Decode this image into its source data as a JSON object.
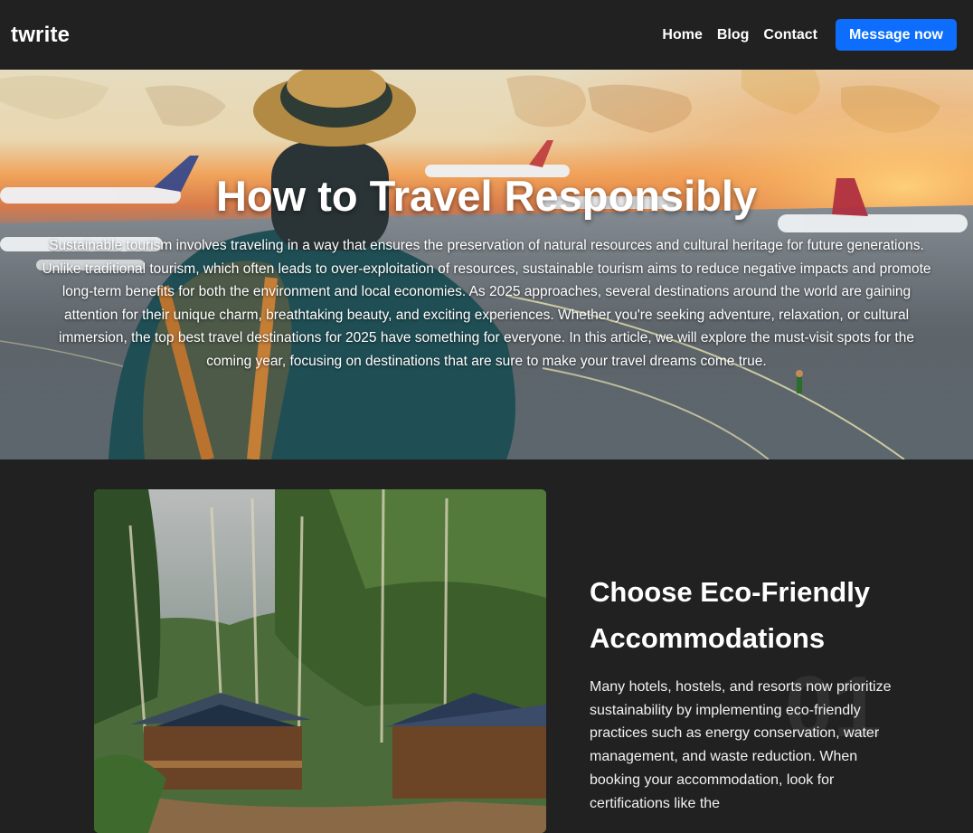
{
  "navbar": {
    "brand": "twrite",
    "links": [
      "Home",
      "Blog",
      "Contact"
    ],
    "cta_label": "Message now",
    "cta_color": "#0d6efd"
  },
  "hero": {
    "title": "How to Travel Responsibly",
    "text": "Sustainable tourism involves traveling in a way that ensures the preservation of natural resources and cultural heritage for future generations. Unlike traditional tourism, which often leads to over-exploitation of resources, sustainable tourism aims to reduce negative impacts and promote long-term benefits for both the environment and local economies. As 2025 approaches, several destinations around the world are gaining attention for their unique charm, breathtaking beauty, and exciting experiences. Whether you're seeking adventure, relaxation, or cultural immersion, the top best travel destinations for 2025 have something for everyone. In this article, we will explore the must-visit spots for the coming year, focusing on destinations that are sure to make your travel dreams come true."
  },
  "feature": {
    "number": "01",
    "title": "Choose Eco-Friendly Accommodations",
    "text": "Many hotels, hostels, and resorts now prioritize sustainability by implementing eco-friendly practices such as energy conservation, water management, and waste reduction. When booking your accommodation, look for certifications like the"
  },
  "colors": {
    "background": "#212121",
    "accent": "#0d6efd"
  }
}
